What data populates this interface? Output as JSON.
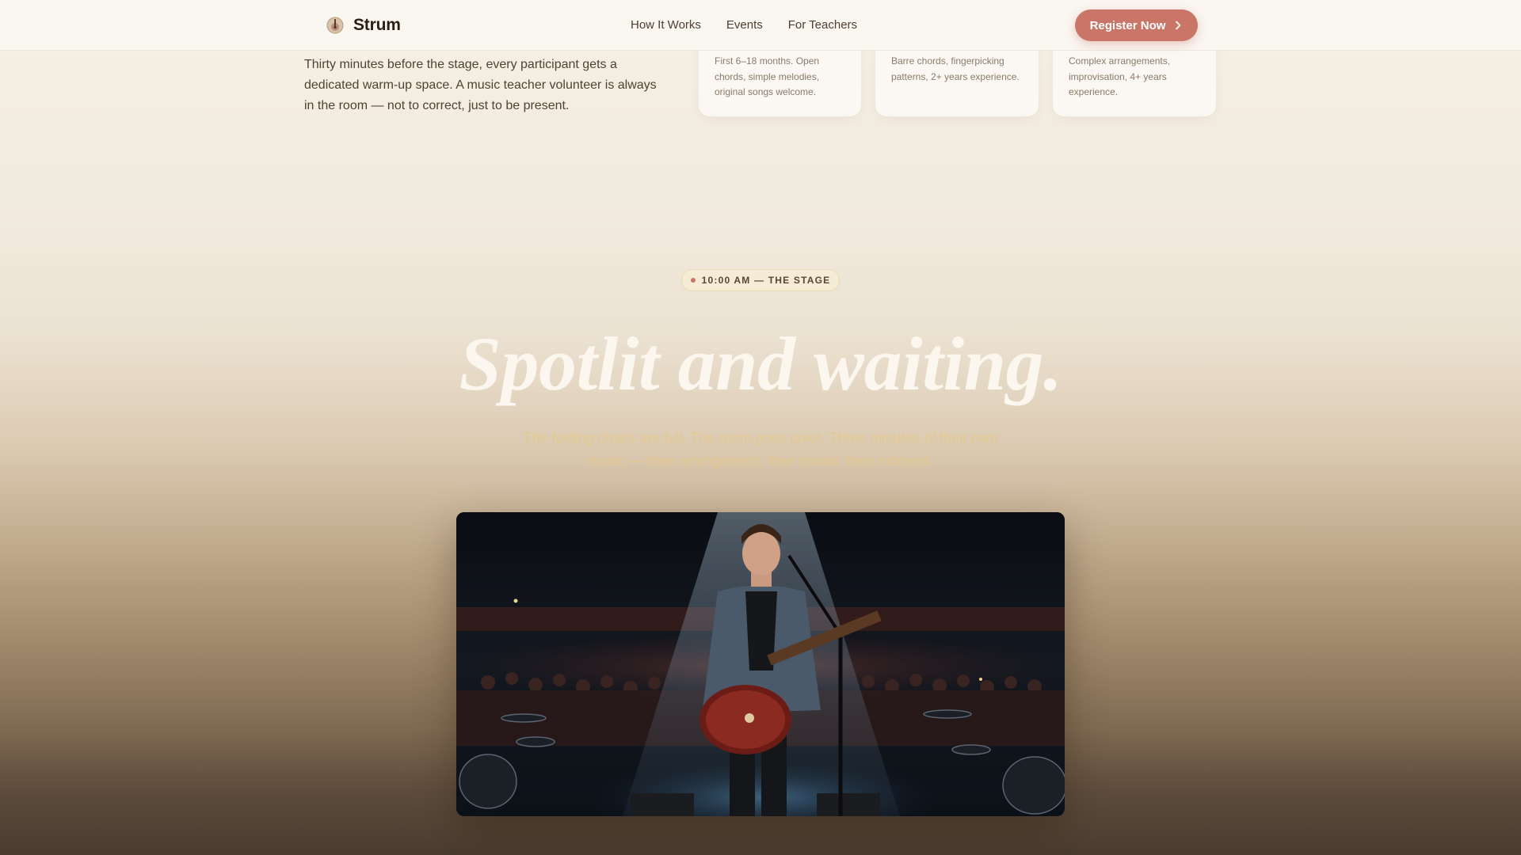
{
  "nav": {
    "brand": "Strum",
    "links": [
      "How It Works",
      "Events",
      "For Teachers"
    ],
    "register_label": "Register Now"
  },
  "warmup": {
    "text": "Thirty minutes before the stage, every participant gets a dedicated warm-up space. A music teacher volunteer is always in the room — not to correct, just to be present."
  },
  "levels": [
    {
      "description": "First 6–18 months. Open chords, simple melodies, original songs welcome."
    },
    {
      "description": "Barre chords, fingerpicking patterns, 2+ years experience."
    },
    {
      "description": "Complex arrangements, improvisation, 4+ years experience."
    }
  ],
  "stage": {
    "badge": "10:00 AM — THE STAGE",
    "heading": "Spotlit and waiting.",
    "subtitle": "The folding chairs are full. The room goes quiet. Three minutes of their own music — their arrangement, their sound, their moment."
  },
  "colors": {
    "accent": "#c97567",
    "heading": "#fbf6ee",
    "subtitle": "#e3c98f",
    "badge_border": "#e9d9b6"
  },
  "icons": {
    "brand": "guitar-logo-icon",
    "register": "chevron-right-icon"
  }
}
